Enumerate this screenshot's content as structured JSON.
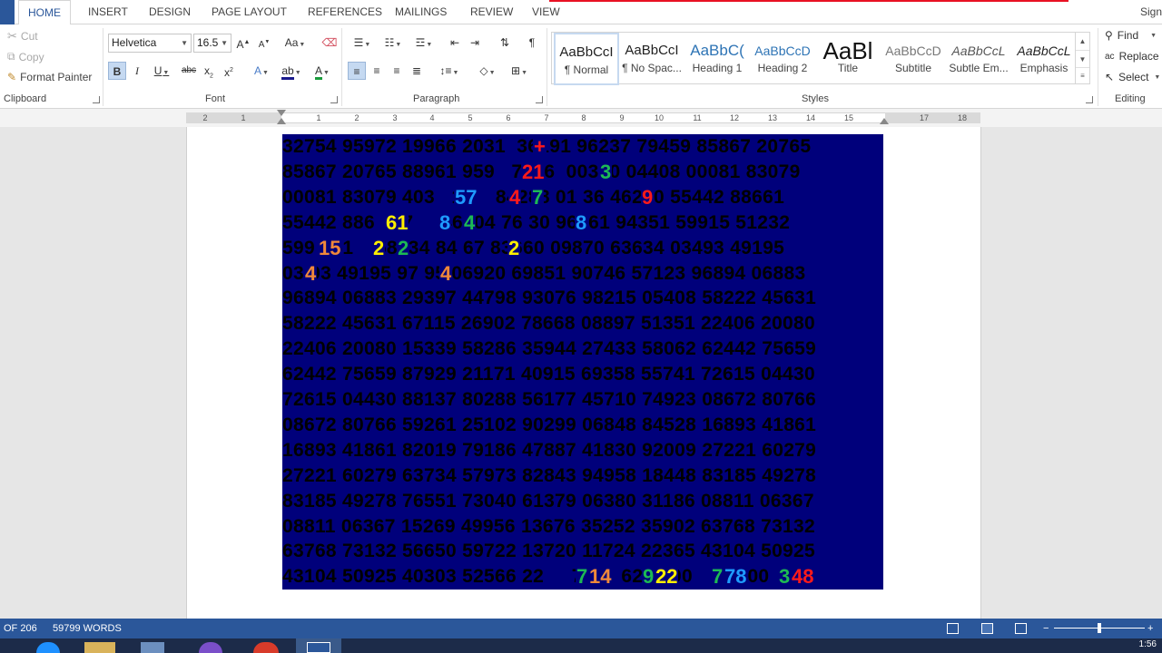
{
  "ribbon_tabs": [
    "HOME",
    "INSERT",
    "DESIGN",
    "PAGE LAYOUT",
    "REFERENCES",
    "MAILINGS",
    "REVIEW",
    "VIEW"
  ],
  "signin": "Sign",
  "clipboard": {
    "cut": "Cut",
    "copy": "Copy",
    "format_painter": "Format Painter",
    "label": "Clipboard"
  },
  "font": {
    "family": "Helvetica",
    "size": "16.5",
    "label": "Font"
  },
  "paragraph": {
    "label": "Paragraph"
  },
  "styles": {
    "label": "Styles",
    "items": [
      {
        "sample": "AaBbCcI",
        "name": "¶ Normal"
      },
      {
        "sample": "AaBbCcI",
        "name": "¶ No Spac..."
      },
      {
        "sample": "AaBbC(",
        "name": "Heading 1"
      },
      {
        "sample": "AaBbCcD",
        "name": "Heading 2"
      },
      {
        "sample": "AaBl",
        "name": "Title"
      },
      {
        "sample": "AaBbCcD",
        "name": "Subtitle"
      },
      {
        "sample": "AaBbCcL",
        "name": "Subtle Em..."
      },
      {
        "sample": "AaBbCcL",
        "name": "Emphasis"
      }
    ]
  },
  "editing": {
    "find": "Find",
    "replace": "Replace",
    "select": "Select",
    "label": "Editing"
  },
  "ruler_numbers": [
    "2",
    "1",
    "",
    "1",
    "2",
    "3",
    "4",
    "5",
    "6",
    "7",
    "8",
    "9",
    "10",
    "11",
    "12",
    "13",
    "14",
    "15",
    "",
    "17",
    "18"
  ],
  "document": {
    "rows": [
      "32754 95972 19966 2031  36191 96237 79459 85867 20765",
      "85867 20765 88961 959   7196  00370 04408 00081 83079",
      "00081 83079 403   13    84288 01 36 46260 55442 88661",
      "55442 886   57     46904 76 30 96361 94351 59915 51232",
      "599   51    58534 84 67 83660 09870 63634 03493 49195",
      "03 93 49195 97 95 06920 69851 90746 57123 96894 06883",
      "96894 06883 29397 44798 93076 98215 05408 58222 45631",
      "58222 45631 67115 26902 78668 08897 51351 22406 20080",
      "22406 20080 15339 58286 35944 27433 58062 62442 75659",
      "62442 75659 87929 21171 40915 69358 55741 72615 04430",
      "72615 04430 88137 80288 56177 45710 74923 08672 80766",
      "08672 80766 59261 25102 90299 06848 84528 16893 41861",
      "16893 41861 82019 79186 47887 41830 92009 27221 60279",
      "27221 60279 63734 57973 82843 94958 18448 83185 49278",
      "83185 49278 76551 73040 61379 06380 31186 08811 06367",
      "08811 06367 15269 49956 13676 35252 35902 63768 73132",
      "63768 73132 56650 59722 13720 11724 22365 43104 50925",
      "43104 50925 40303 52566 22     76     62     00    00000"
    ],
    "highlights": [
      {
        "text": "+",
        "color": "#ff1a1a"
      },
      {
        "text": "21",
        "color": "#ff1a1a"
      },
      {
        "text": "3",
        "color": "#1db954"
      },
      {
        "text": "57",
        "color": "#1e9bff"
      },
      {
        "text": "4",
        "color": "#ff1a1a"
      },
      {
        "text": "7",
        "color": "#1db954"
      },
      {
        "text": "9",
        "color": "#ff1a1a"
      },
      {
        "text": "61",
        "color": "#ffee00"
      },
      {
        "text": "8",
        "color": "#1e9bff"
      },
      {
        "text": "4",
        "color": "#1db954"
      },
      {
        "text": "8",
        "color": "#1e9bff"
      },
      {
        "text": "15",
        "color": "#f0883a"
      },
      {
        "text": "2",
        "color": "#ffee00"
      },
      {
        "text": "2",
        "color": "#1db954"
      },
      {
        "text": "2",
        "color": "#ffee00"
      },
      {
        "text": "4",
        "color": "#f0883a"
      },
      {
        "text": "4",
        "color": "#f0883a"
      },
      {
        "text": "7",
        "color": "#1db954"
      },
      {
        "text": "14",
        "color": "#f0883a"
      },
      {
        "text": "9",
        "color": "#1db954"
      },
      {
        "text": "22",
        "color": "#ffee00"
      },
      {
        "text": "7",
        "color": "#1db954"
      },
      {
        "text": "78",
        "color": "#1e9bff"
      },
      {
        "text": "3",
        "color": "#1db954"
      },
      {
        "text": "48",
        "color": "#ff1a1a"
      }
    ]
  },
  "status": {
    "page": "OF 206",
    "words": "59799 WORDS"
  },
  "clock": "1:56"
}
